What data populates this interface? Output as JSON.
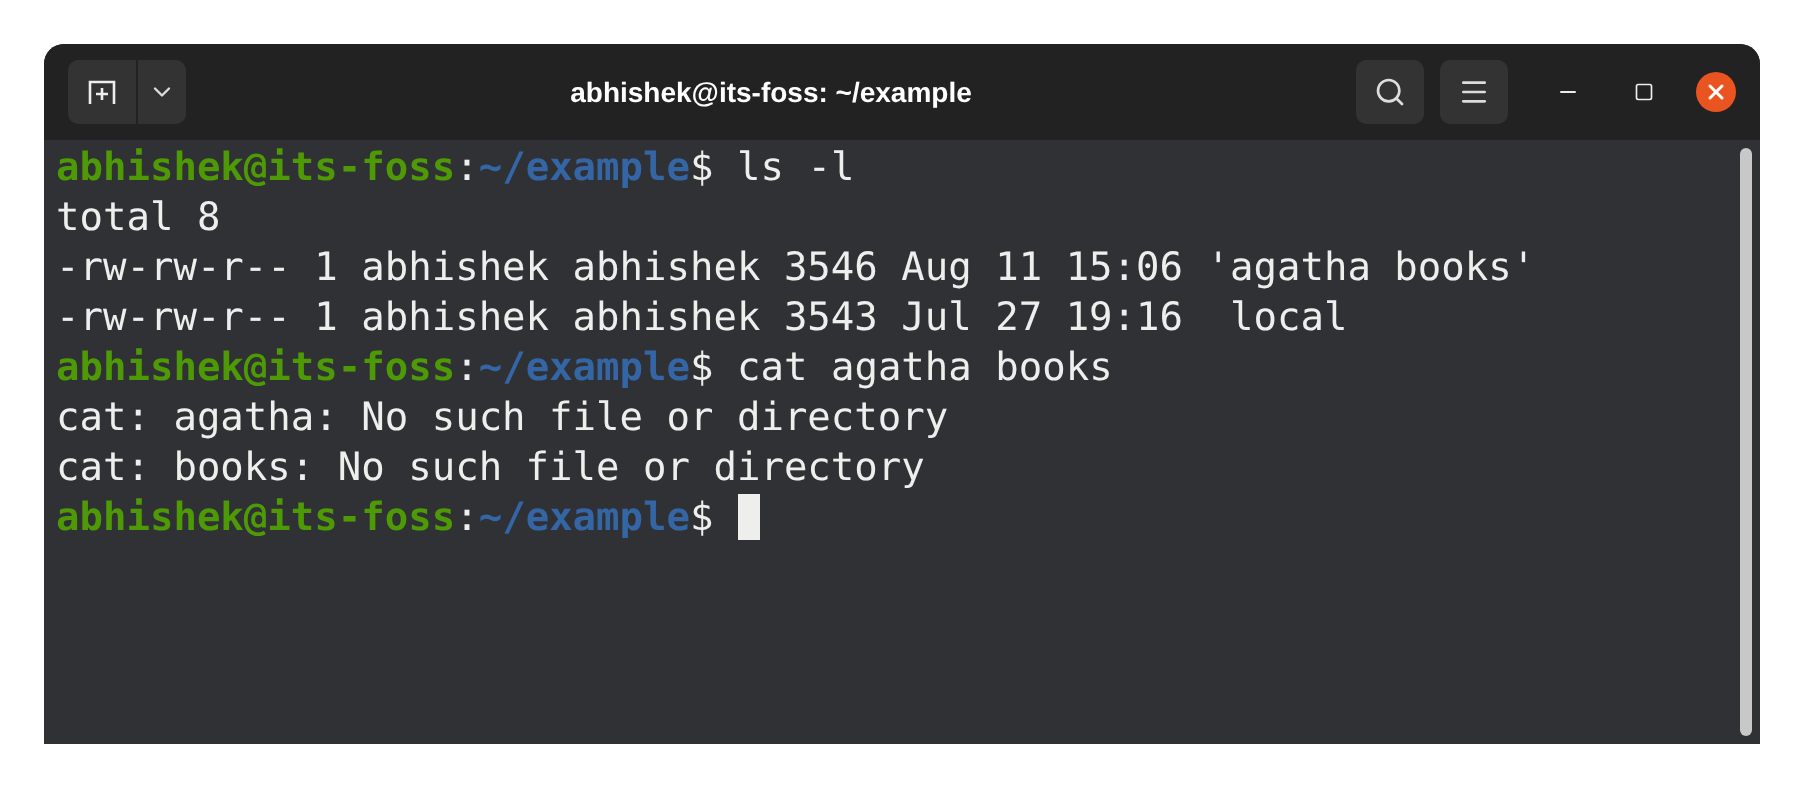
{
  "window": {
    "title": "abhishek@its-foss: ~/example"
  },
  "terminal": {
    "lines": [
      {
        "kind": "prompt",
        "user": "abhishek@its-foss",
        "separator": ":",
        "path": "~/example",
        "symbol": "$",
        "command": " ls -l",
        "cursor": false
      },
      {
        "kind": "output",
        "text": "total 8"
      },
      {
        "kind": "output",
        "text": "-rw-rw-r-- 1 abhishek abhishek 3546 Aug 11 15:06 'agatha books'"
      },
      {
        "kind": "output",
        "text": "-rw-rw-r-- 1 abhishek abhishek 3543 Jul 27 19:16  local"
      },
      {
        "kind": "prompt",
        "user": "abhishek@its-foss",
        "separator": ":",
        "path": "~/example",
        "symbol": "$",
        "command": " cat agatha books",
        "cursor": false
      },
      {
        "kind": "output",
        "text": "cat: agatha: No such file or directory"
      },
      {
        "kind": "output",
        "text": "cat: books: No such file or directory"
      },
      {
        "kind": "prompt",
        "user": "abhishek@its-foss",
        "separator": ":",
        "path": "~/example",
        "symbol": "$",
        "cursor": true
      }
    ]
  }
}
